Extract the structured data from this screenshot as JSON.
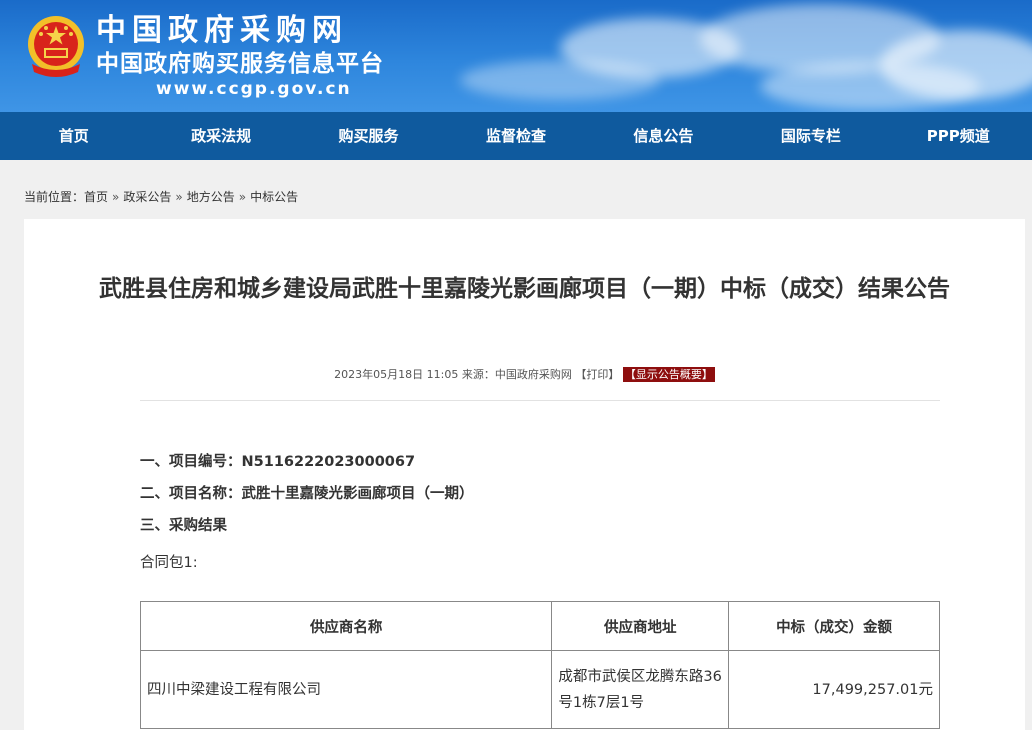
{
  "header": {
    "site_name": "中国政府采购网",
    "site_subtitle": "中国政府购买服务信息平台",
    "site_url": "www.ccgp.gov.cn",
    "colors": {
      "header_blue": "#2e86dd",
      "nav_blue": "#0f5a9e",
      "badge_red": "#8e0e0e"
    },
    "emblem_icon": "national-emblem-icon"
  },
  "nav": {
    "items": [
      {
        "label": "首页"
      },
      {
        "label": "政采法规"
      },
      {
        "label": "购买服务"
      },
      {
        "label": "监督检查"
      },
      {
        "label": "信息公告"
      },
      {
        "label": "国际专栏"
      },
      {
        "label": "PPP频道"
      }
    ]
  },
  "breadcrumb": {
    "prefix": "当前位置：",
    "items": [
      "首页",
      "政采公告",
      "地方公告",
      "中标公告"
    ],
    "separator": "»"
  },
  "article": {
    "title": "武胜县住房和城乡建设局武胜十里嘉陵光影画廊项目（一期）中标（成交）结果公告",
    "meta": {
      "datetime": "2023年05月18日 11:05",
      "source": "来源：中国政府采购网",
      "print_label": "【打印】",
      "summary_label": "【显示公告概要】"
    },
    "project_number": "一、项目编号：N5116222023000067",
    "project_name": "二、项目名称：武胜十里嘉陵光影画廊项目（一期）",
    "section_result": "三、采购结果",
    "package_label": "合同包1:",
    "table": {
      "headers": [
        "供应商名称",
        "供应商地址",
        "中标（成交）金额"
      ],
      "rows": [
        {
          "supplier_name": "四川中梁建设工程有限公司",
          "supplier_address": "成都市武侯区龙腾东路36号1栋7层1号",
          "amount": "17,499,257.01元"
        }
      ]
    }
  }
}
